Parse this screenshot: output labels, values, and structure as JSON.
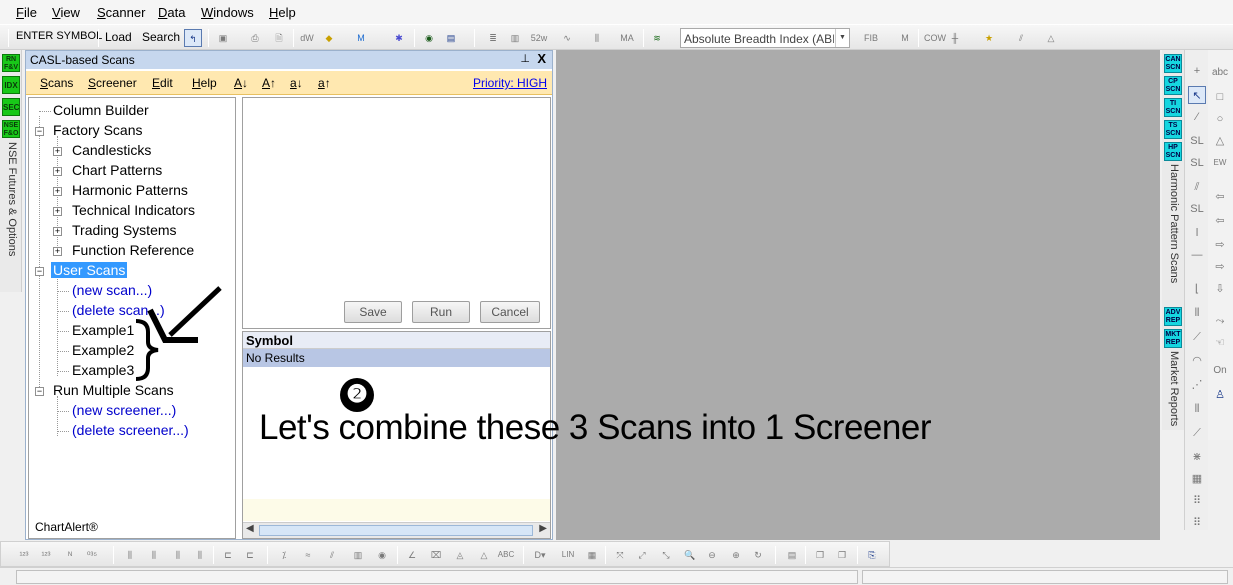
{
  "menubar": {
    "items": [
      "File",
      "View",
      "Scanner",
      "Data",
      "Windows",
      "Help"
    ]
  },
  "toolbar": {
    "enter_symbol": "ENTER SYMBOL",
    "load": "Load",
    "search": "Search",
    "indicator_dropdown": "Absolute Breadth Index (ABI"
  },
  "left_strip": {
    "badges": [
      "RN F&V",
      "IDX",
      "SEC",
      "NSE F&O"
    ],
    "vertical_label": "NSE Futures & Options"
  },
  "casl_pane": {
    "title": "CASL-based Scans",
    "pin_icon": "pin-icon",
    "close_label": "X",
    "menu": [
      "Scans",
      "Screener",
      "Edit",
      "Help"
    ],
    "font_buttons": [
      "A↓",
      "A↑",
      "a↓",
      "a↑"
    ],
    "priority": "Priority: HIGH",
    "tree": {
      "column_builder": "Column Builder",
      "factory_scans": "Factory Scans",
      "factory_children": [
        "Candlesticks",
        "Chart Patterns",
        "Harmonic Patterns",
        "Technical Indicators",
        "Trading Systems",
        "Function Reference"
      ],
      "user_scans": "User Scans",
      "new_scan": "(new scan...)",
      "delete_scan": "(delete scan...)",
      "examples": [
        "Example1",
        "Example2",
        "Example3"
      ],
      "run_multiple": "Run Multiple Scans",
      "new_screener": "(new screener...)",
      "delete_screener": "(delete screener...)"
    },
    "footer": "ChartAlert®",
    "buttons": {
      "save": "Save",
      "run": "Run",
      "cancel": "Cancel"
    },
    "results": {
      "header": "Symbol",
      "empty": "No Results"
    }
  },
  "annotation": {
    "step_number": "❷",
    "text": "Let's combine these 3 Scans into 1 Screener"
  },
  "right_strip": {
    "badges_top": [
      "CAN SCN",
      "CP SCN",
      "TI SCN",
      "TS SCN",
      "HP SCN"
    ],
    "label_top": "Harmonic Pattern Scans",
    "badges_bottom": [
      "ADV REP",
      "MKT REP"
    ],
    "label_bottom": "Market Reports"
  },
  "drawing_toolbar": {
    "text_tool": "abc",
    "on_label": "On"
  },
  "colors": {
    "pane_title": "#c6d7ee",
    "casl_menu": "#ffe8b0",
    "selection": "#3399ff",
    "chart_area": "#ababab",
    "scan_badge": "#16d6e0",
    "exchange_badge": "#18c818"
  }
}
